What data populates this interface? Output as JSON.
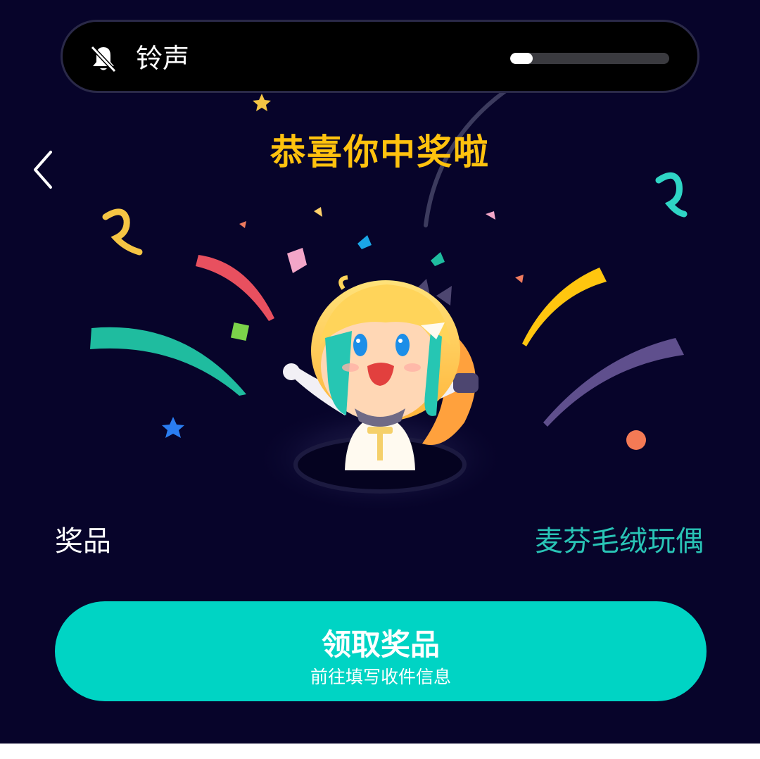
{
  "volume": {
    "label": "铃声",
    "icon": "bell-muted-icon",
    "level": 0.14
  },
  "header": {
    "back_icon": "chevron-left-icon",
    "title": "恭喜你中奖啦"
  },
  "prize": {
    "label": "奖品",
    "name": "麦芬毛绒玩偶"
  },
  "claim": {
    "title": "领取奖品",
    "subtitle": "前往填写收件信息"
  },
  "colors": {
    "background": "#07042a",
    "title": "#ffc20e",
    "accent": "#00d4c4",
    "prize_name": "#29c4b6"
  }
}
